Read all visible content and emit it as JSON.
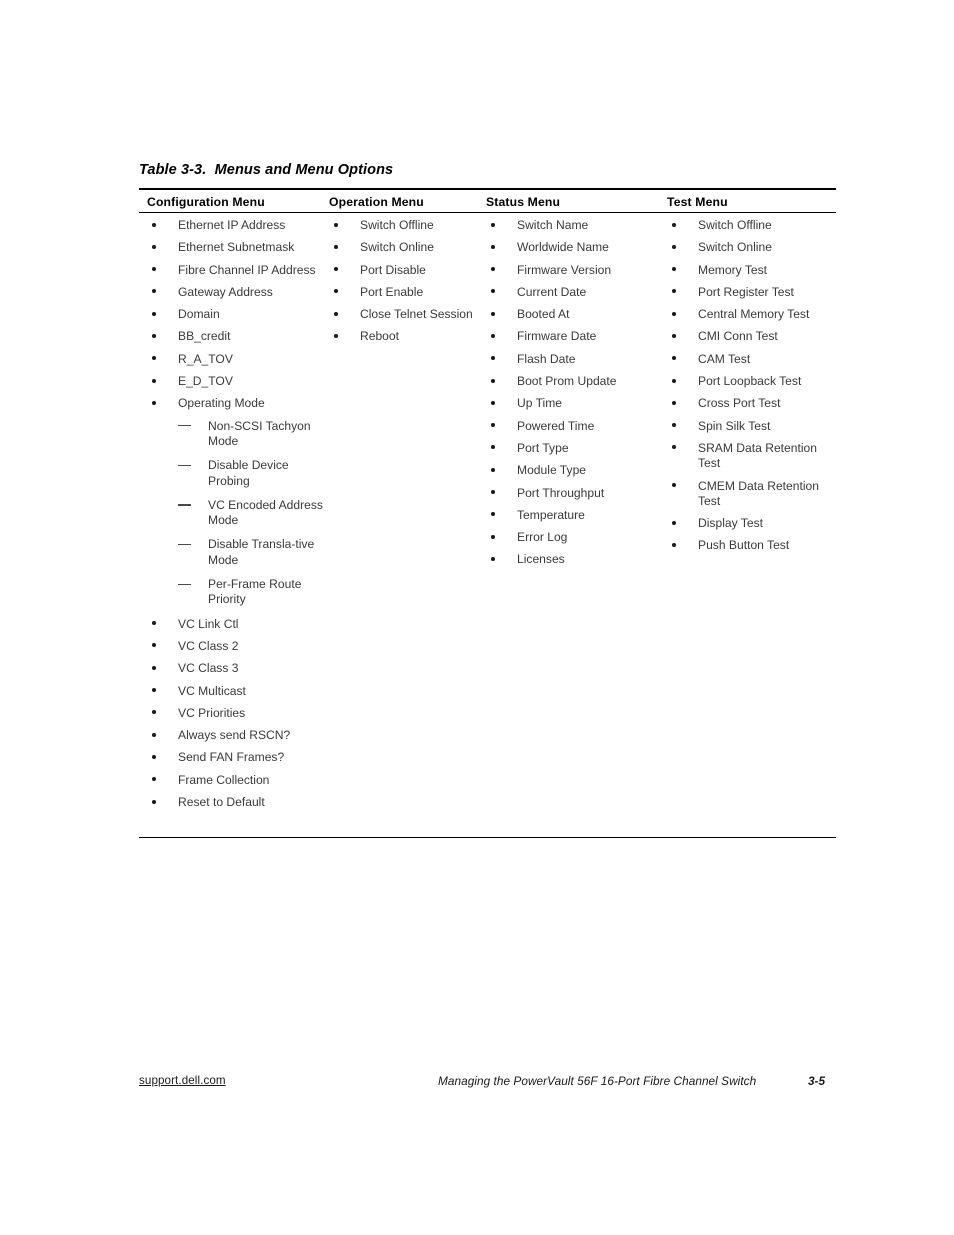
{
  "table": {
    "caption": "Table 3-3.  Menus and Menu Options",
    "columns": [
      {
        "header": "Configuration Menu",
        "items": [
          {
            "label": "Ethernet IP Address"
          },
          {
            "label": "Ethernet Subnetmask"
          },
          {
            "label": "Fibre Channel IP Address"
          },
          {
            "label": "Gateway Address"
          },
          {
            "label": "Domain"
          },
          {
            "label": "BB_credit"
          },
          {
            "label": "R_A_TOV"
          },
          {
            "label": "E_D_TOV"
          },
          {
            "label": "Operating Mode",
            "subitems": [
              "Non-SCSI Tachyon Mode",
              "Disable Device Probing",
              "VC Encoded Address Mode",
              "Disable Transla-tive Mode",
              "Per-Frame Route Priority"
            ]
          },
          {
            "label": "VC Link Ctl"
          },
          {
            "label": "VC Class 2"
          },
          {
            "label": "VC Class 3"
          },
          {
            "label": "VC Multicast"
          },
          {
            "label": "VC Priorities"
          },
          {
            "label": "Always send RSCN?"
          },
          {
            "label": "Send FAN Frames?"
          },
          {
            "label": "Frame Collection"
          },
          {
            "label": "Reset to Default"
          }
        ]
      },
      {
        "header": "Operation Menu",
        "items": [
          {
            "label": "Switch Offline"
          },
          {
            "label": "Switch Online"
          },
          {
            "label": "Port Disable"
          },
          {
            "label": "Port Enable"
          },
          {
            "label": "Close Telnet Session"
          },
          {
            "label": "Reboot"
          }
        ]
      },
      {
        "header": "Status Menu",
        "items": [
          {
            "label": "Switch Name"
          },
          {
            "label": "Worldwide Name"
          },
          {
            "label": "Firmware Version"
          },
          {
            "label": "Current Date"
          },
          {
            "label": "Booted At"
          },
          {
            "label": "Firmware Date"
          },
          {
            "label": "Flash Date"
          },
          {
            "label": "Boot Prom Update"
          },
          {
            "label": "Up Time"
          },
          {
            "label": "Powered Time"
          },
          {
            "label": "Port Type"
          },
          {
            "label": "Module Type"
          },
          {
            "label": "Port Throughput"
          },
          {
            "label": "Temperature"
          },
          {
            "label": "Error Log"
          },
          {
            "label": "Licenses"
          }
        ]
      },
      {
        "header": "Test Menu",
        "items": [
          {
            "label": "Switch Offline"
          },
          {
            "label": "Switch Online"
          },
          {
            "label": "Memory Test"
          },
          {
            "label": "Port Register Test"
          },
          {
            "label": "Central Memory Test"
          },
          {
            "label": "CMI Conn Test"
          },
          {
            "label": "CAM Test"
          },
          {
            "label": "Port Loopback Test"
          },
          {
            "label": "Cross Port Test"
          },
          {
            "label": "Spin Silk Test"
          },
          {
            "label": "SRAM Data Retention Test"
          },
          {
            "label": "CMEM Data Retention Test"
          },
          {
            "label": "Display Test"
          },
          {
            "label": "Push Button Test"
          }
        ]
      }
    ]
  },
  "footer": {
    "link": "support.dell.com",
    "title": "Managing the PowerVault 56F 16-Port Fibre Channel Switch",
    "page": "3-5"
  }
}
